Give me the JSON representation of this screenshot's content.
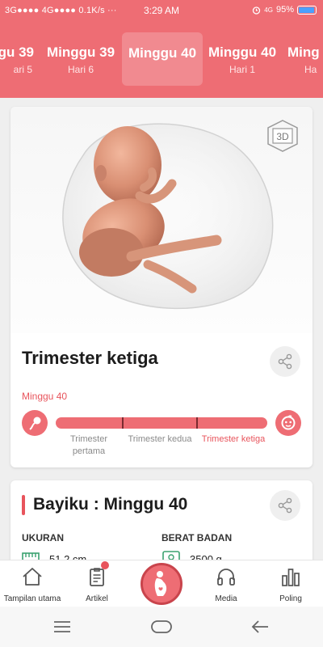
{
  "status_bar": {
    "left": "3G●●●● 4G●●●● 0.1K/s ···",
    "time": "3:29 AM",
    "alarm_icon": "alarm-icon",
    "network": "4G",
    "battery": "95%"
  },
  "tabs": [
    {
      "week": "gu 39",
      "day": "ari 5"
    },
    {
      "week": "Minggu 39",
      "day": "Hari 6"
    },
    {
      "week": "Minggu 40",
      "day": ""
    },
    {
      "week": "Minggu 40",
      "day": "Hari 1"
    },
    {
      "week": "Ming",
      "day": "Ha"
    }
  ],
  "card1": {
    "badge_3d": "3D",
    "title": "Trimester ketiga",
    "current_week": "Minggu 40",
    "trimesters": [
      "Trimester pertama",
      "Trimester kedua",
      "Trimester ketiga"
    ],
    "current_trimester_index": 2,
    "progress_percent": 100
  },
  "card2": {
    "title": "Bayiku : Minggu 40",
    "size_label": "UKURAN",
    "size_value": "51,2 cm",
    "weight_label": "BERAT BADAN",
    "weight_value": "3500 g"
  },
  "bottom_nav": [
    {
      "label": "Tampilan utama",
      "icon": "home-icon"
    },
    {
      "label": "Artikel",
      "icon": "clipboard-icon"
    },
    {
      "label": "",
      "icon": "pregnant-woman-icon"
    },
    {
      "label": "Media",
      "icon": "headphones-icon"
    },
    {
      "label": "Poling",
      "icon": "bar-chart-icon"
    }
  ],
  "colors": {
    "brand": "#ee6d74",
    "accent_text": "#e8545c",
    "card": "#ffffff"
  }
}
